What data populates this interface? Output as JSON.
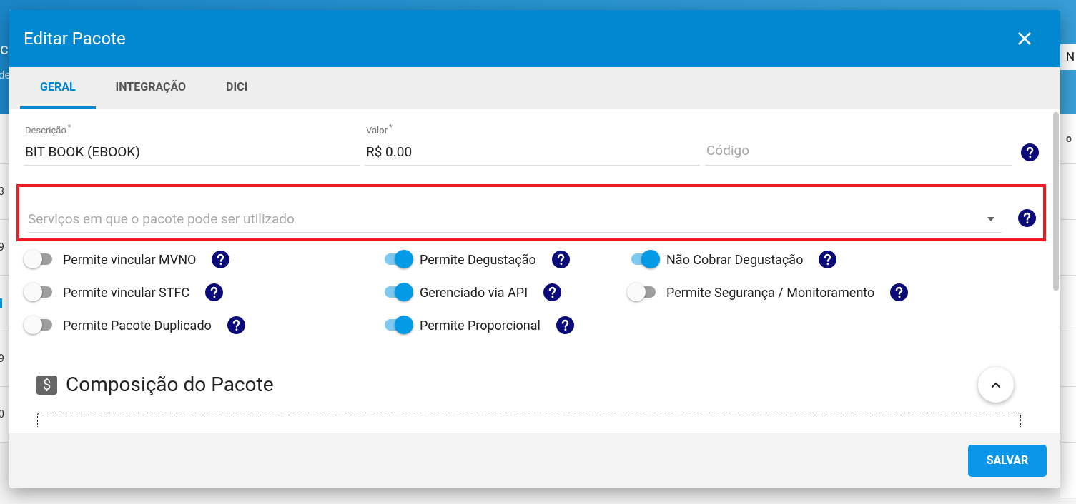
{
  "background": {
    "left_title": "c",
    "left_subtitle": "de",
    "left_rows": [
      "3",
      "9",
      "",
      "9",
      "0"
    ],
    "right_header": "N",
    "right_column": "o"
  },
  "dialog": {
    "title": "Editar Pacote",
    "tabs": [
      {
        "label": "GERAL",
        "selected": true
      },
      {
        "label": "INTEGRAÇÃO",
        "selected": false
      },
      {
        "label": "DICI",
        "selected": false
      }
    ],
    "fields": [
      {
        "label": "Descrição",
        "required_mark": "*",
        "value": "BIT BOOK (EBOOK)"
      },
      {
        "label": "Valor",
        "required_mark": "*",
        "value": "R$ 0.00"
      },
      {
        "placeholder": "Código"
      }
    ],
    "services_select": {
      "placeholder": "Serviços em que o pacote pode ser utilizado",
      "highlighted": true
    },
    "toggle_columns": [
      [
        {
          "label": "Permite vincular MVNO",
          "on": false
        },
        {
          "label": "Permite vincular STFC",
          "on": false
        },
        {
          "label": "Permite Pacote Duplicado",
          "on": false
        }
      ],
      [
        {
          "label": "Permite Degustação",
          "on": true
        },
        {
          "label": "Gerenciado via API",
          "on": true
        },
        {
          "label": "Permite Proporcional",
          "on": true
        }
      ],
      [
        {
          "label": "Não Cobrar Degustação",
          "on": true
        },
        {
          "label": "Permite Segurança / Monitoramento",
          "on": false
        }
      ]
    ],
    "section": {
      "title": "Composição do Pacote",
      "icon": "$"
    },
    "save_button": "SALVAR"
  }
}
